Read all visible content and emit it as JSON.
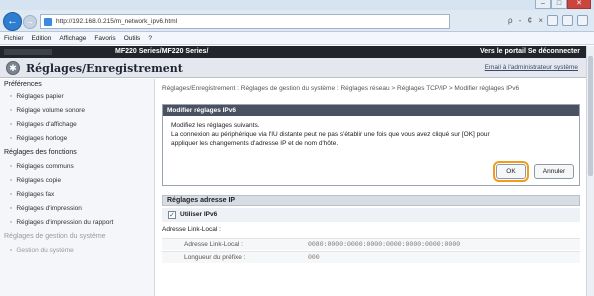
{
  "browser": {
    "url": "http://192.168.0.215/m_network_ipv6.html",
    "address_tools": "ρ - ¢ ×",
    "menu": [
      "Fichier",
      "Edition",
      "Affichage",
      "Favoris",
      "Outils",
      "?"
    ]
  },
  "topbar": {
    "model": "MF220 Series/MF220 Series/",
    "links": "Vers le portail   Se déconnecter"
  },
  "header": {
    "title": "Réglages/Enregistrement",
    "mail_link": "Email à l'administrateur système"
  },
  "sidebar": {
    "items": [
      {
        "label": "Préférences",
        "level": "head"
      },
      {
        "label": "Réglages papier",
        "level": "sub"
      },
      {
        "label": "Réglage volume sonore",
        "level": "sub"
      },
      {
        "label": "Réglages d'affichage",
        "level": "sub"
      },
      {
        "label": "Réglages horloge",
        "level": "sub"
      },
      {
        "label": "Réglages des fonctions",
        "level": "head"
      },
      {
        "label": "Réglages communs",
        "level": "sub"
      },
      {
        "label": "Réglages copie",
        "level": "sub"
      },
      {
        "label": "Réglages fax",
        "level": "sub"
      },
      {
        "label": "Réglages d'impression",
        "level": "sub"
      },
      {
        "label": "Réglages d'impression du rapport",
        "level": "sub"
      },
      {
        "label": "Réglages de gestion du système",
        "level": "head-dim"
      },
      {
        "label": "Gestion du système",
        "level": "sub-dim"
      }
    ]
  },
  "main": {
    "breadcrumb": "Réglages/Enregistrement : Réglages de gestion du système : Réglages réseau > Réglages TCP/IP > Modifier réglages IPv6",
    "modal": {
      "title": "Modifier réglages IPv6",
      "line1": "Modifiez les réglages suivants.",
      "line2": "La connexion au périphérique via l'IU distante peut ne pas s'établir une fois que vous avez cliqué sur [OK] pour",
      "line3": "appliquer les changements d'adresse IP et de nom d'hôte.",
      "ok_label": "OK",
      "cancel_label": "Annuler"
    },
    "section_title": "Réglages adresse IP",
    "use_ipv6_label": "Utiliser IPv6",
    "use_ipv6_checked": "✓",
    "link_local_title": "Adresse Link-Local :",
    "rows": [
      {
        "key": "Adresse Link-Local :",
        "value": "0080:0000:0000:0000:0000:0000:0000:0000"
      },
      {
        "key": "Longueur du préfixe :",
        "value": "000"
      }
    ]
  }
}
